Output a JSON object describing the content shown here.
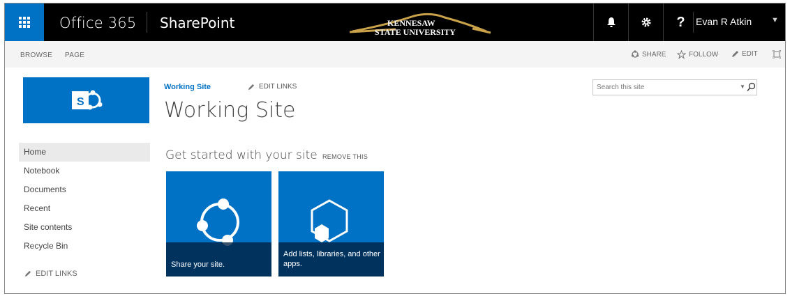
{
  "suite_bar": {
    "brand": "Office 365",
    "app_name": "SharePoint",
    "logo_line1": "KENNESAW",
    "logo_line2": "STATE UNIVERSITY",
    "help_glyph": "?",
    "user_name": "Evan R Atkin",
    "icons": {
      "app_launcher": "waffle-icon",
      "notifications": "bell-icon",
      "settings": "gear-icon",
      "help": "question-icon",
      "user_menu": "chevron-down-icon"
    }
  },
  "ribbon": {
    "tabs": [
      "BROWSE",
      "PAGE"
    ],
    "share": "SHARE",
    "follow": "FOLLOW",
    "edit": "EDIT"
  },
  "site": {
    "breadcrumb": "Working Site",
    "edit_links": "EDIT LINKS",
    "title": "Working Site",
    "logo_letter": "S"
  },
  "nav": {
    "items": [
      "Home",
      "Notebook",
      "Documents",
      "Recent",
      "Site contents",
      "Recycle Bin"
    ],
    "edit_links": "EDIT LINKS"
  },
  "search": {
    "placeholder": "Search this site"
  },
  "get_started": {
    "title": "Get started with your site",
    "remove": "REMOVE THIS",
    "tiles": [
      {
        "label": "Share your site."
      },
      {
        "label": "Add lists, libraries, and other apps."
      }
    ]
  },
  "colors": {
    "suite_bar": "#000000",
    "accent": "#0072c6",
    "logo_gold": "#c9a24a"
  }
}
